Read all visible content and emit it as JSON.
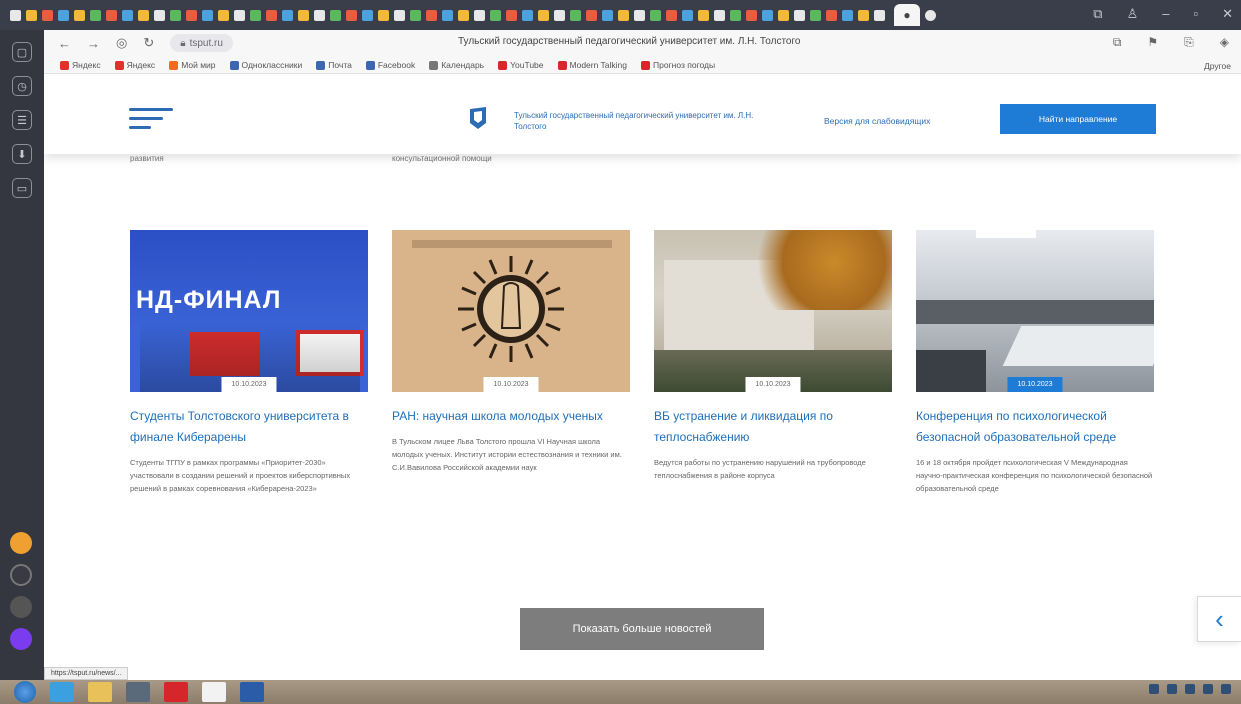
{
  "browser": {
    "tab_title": "Тульский государственный педагогический университет им. Л.Н. Толстого",
    "url_host": "tsput.ru",
    "bookmarks": [
      {
        "label": "Яндекс",
        "color": "#e0312a"
      },
      {
        "label": "Яндекс",
        "color": "#e0312a"
      },
      {
        "label": "Мой мир",
        "color": "#f26a1b"
      },
      {
        "label": "Одноклассники",
        "color": "#3a67b0"
      },
      {
        "label": "Почта",
        "color": "#3a67b0"
      },
      {
        "label": "Facebook",
        "color": "#3a67b0"
      },
      {
        "label": "Календарь",
        "color": "#777777"
      },
      {
        "label": "YouTube",
        "color": "#d9262b"
      },
      {
        "label": "Modern Talking",
        "color": "#d9262b"
      },
      {
        "label": "Прогноз погоды",
        "color": "#d9262b"
      }
    ],
    "bookmarks_other": "Другое",
    "status_url": "https://tsput.ru/news/..."
  },
  "header": {
    "logo_text": "Тульский государственный педагогический университет им. Л.Н. Толстого",
    "vision_link": "Версия для слабовидящих",
    "cta_label": "Найти направление"
  },
  "previous_row": [
    "развития",
    "консультационной помощи"
  ],
  "news": [
    {
      "date": "10.10.2023",
      "title": "Студенты Толстовского университета в финале Киберарены",
      "desc": "Студенты ТГПУ в рамках программы «Приоритет-2030» участвовали в создании решений и проектов киберспортивных решений в рамках соревнования «Киберарена-2023»",
      "badge_style": "white",
      "image_banner": "НД-ФИНАЛ"
    },
    {
      "date": "10.10.2023",
      "title": "РАН: научная школа молодых ученых",
      "desc": "В Тульском лицее Льва Толстого прошла VI Научная школа молодых ученых. Институт истории естествознания и техники им. С.И.Вавилова Российской академии наук",
      "badge_style": "white",
      "image_banner": ""
    },
    {
      "date": "10.10.2023",
      "title": "ВБ устранение и ликвидация по теплоснабжению",
      "desc": "Ведутся работы по устранению нарушений на трубопроводе теплоснабжения в районе корпуса",
      "badge_style": "white",
      "image_banner": ""
    },
    {
      "date": "10.10.2023",
      "title": "Конференция по психологической безопасной образовательной среде",
      "desc": "16 и 18 октября пройдет психологическая V Международная научно-практическая конференция по психологической безопасной образовательной среде",
      "badge_style": "blue",
      "image_banner": ""
    }
  ],
  "more_button": "Показать больше новостей",
  "colors": {
    "brand_blue": "#1e7bd6",
    "link_blue": "#1f6fb8",
    "card_1_bg": "#2b4fc4",
    "card_2_bg": "#d9b48a",
    "card_3_bg": "#b9a98f",
    "card_4_bg": "#9aa2ab"
  }
}
